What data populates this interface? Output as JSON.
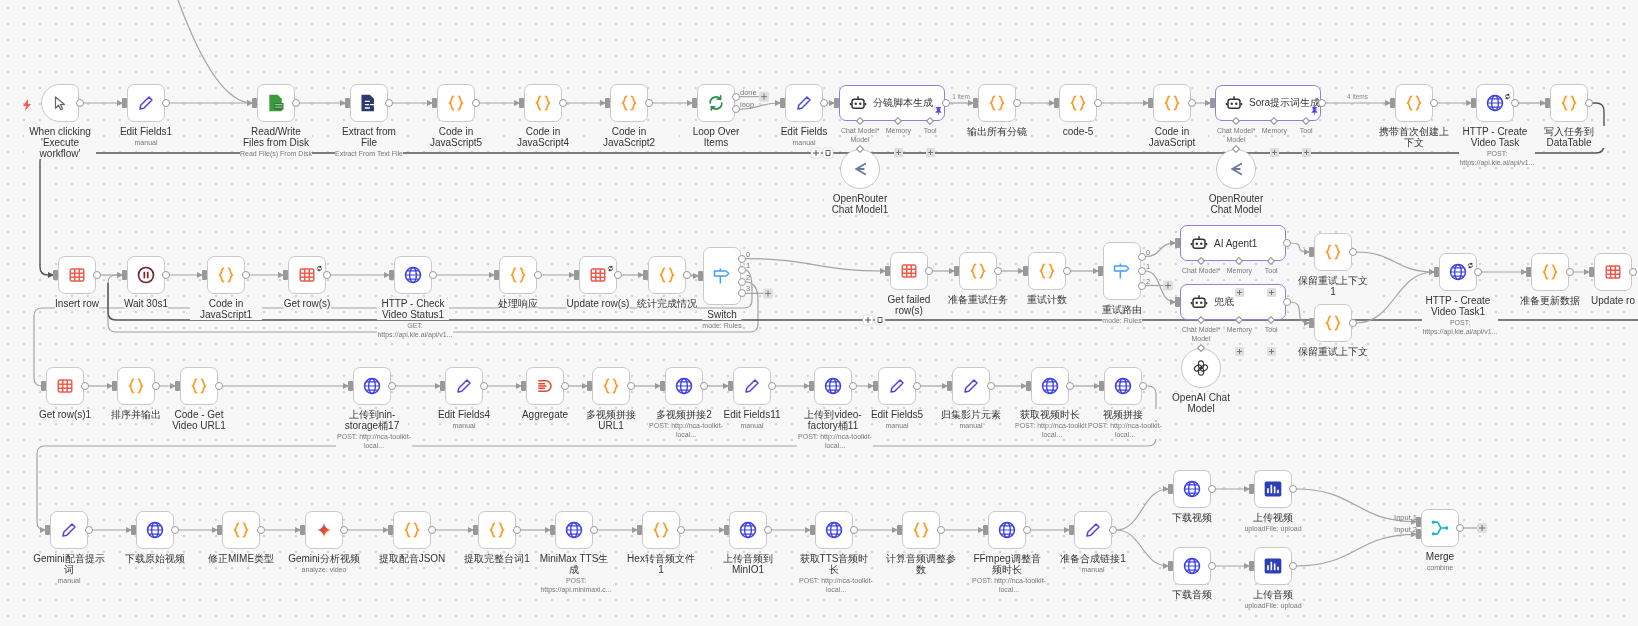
{
  "canvas": {
    "nodes": [
      {
        "kind": "trigger",
        "label": "When clicking 'Execute workflow'"
      },
      {
        "kind": "set",
        "label": "Edit Fields1",
        "subtitle": "manual"
      },
      {
        "kind": "file",
        "label": "Read/Write Files from Disk",
        "subtitle": "Read File(s) From Disk"
      },
      {
        "kind": "extract",
        "label": "Extract from File",
        "subtitle": "Extract From Text File"
      },
      {
        "kind": "code",
        "label": "Code in JavaScript5"
      },
      {
        "kind": "code",
        "label": "Code in JavaScript4"
      },
      {
        "kind": "code",
        "label": "Code in JavaScript2"
      },
      {
        "kind": "loop",
        "label": "Loop Over Items",
        "outputs": [
          "done",
          "loop"
        ]
      },
      {
        "kind": "set",
        "label": "Edit Fields",
        "subtitle": "manual"
      },
      {
        "kind": "agent",
        "label": "分镜脚本生成",
        "pinned": true,
        "ports": [
          "Chat Model*",
          "Memory",
          "Tool"
        ]
      },
      {
        "kind": "code",
        "label": "输出所有分镜"
      },
      {
        "kind": "code",
        "label": "code-5"
      },
      {
        "kind": "code",
        "label": "Code in JavaScript"
      },
      {
        "kind": "agent",
        "label": "Sora提示词生成",
        "pinned": true,
        "ports": [
          "Chat Model*",
          "Memory",
          "Tool"
        ]
      },
      {
        "kind": "code",
        "label": "携带首次创建上下文"
      },
      {
        "kind": "http",
        "label": "HTTP - Create Video Task",
        "subtitle": "POST: https://api.kie.ai/api/v1...",
        "badge": true
      },
      {
        "kind": "code",
        "label": "写入任务到DataTable"
      },
      {
        "kind": "model_router",
        "label": "OpenRouter Chat Model1",
        "port": "Model"
      },
      {
        "kind": "model_router",
        "label": "OpenRouter Chat Model",
        "port": "Model"
      },
      {
        "kind": "table",
        "label": "Insert row"
      },
      {
        "kind": "wait",
        "label": "Wait 30s1"
      },
      {
        "kind": "code",
        "label": "Code in JavaScript1"
      },
      {
        "kind": "table",
        "label": "Get row(s)",
        "badge": true
      },
      {
        "kind": "http",
        "label": "HTTP - Check Video Status1",
        "subtitle": "GET: https://api.kie.ai/api/v1..."
      },
      {
        "kind": "code",
        "label": "处理响应"
      },
      {
        "kind": "table",
        "label": "Update row(s)",
        "badge": true
      },
      {
        "kind": "code",
        "label": "统计完成情况"
      },
      {
        "kind": "switch",
        "label": "Switch",
        "subtitle": "mode: Rules",
        "outputs": [
          "0",
          "1",
          "2",
          "3"
        ]
      },
      {
        "kind": "table",
        "label": "Get failed row(s)"
      },
      {
        "kind": "code",
        "label": "准备重试任务"
      },
      {
        "kind": "code",
        "label": "重试计数"
      },
      {
        "kind": "switch",
        "label": "重试路由",
        "subtitle": "mode: Rules",
        "outputs": [
          "0",
          "1",
          "2"
        ]
      },
      {
        "kind": "agent",
        "label": "AI Agent1",
        "pinned": false,
        "ports": [
          "Chat Model*",
          "Memory",
          "Tool"
        ]
      },
      {
        "kind": "agent",
        "label": "兜底",
        "pinned": false,
        "ports": [
          "Chat Model*",
          "Memory",
          "Tool"
        ]
      },
      {
        "kind": "code",
        "label": "保留重试上下文1"
      },
      {
        "kind": "code",
        "label": "保留重试上下文"
      },
      {
        "kind": "http",
        "label": "HTTP - Create Video Task1",
        "subtitle": "POST: https://api.kie.ai/api/v1...",
        "badge": true
      },
      {
        "kind": "code",
        "label": "准备更新数据"
      },
      {
        "kind": "table",
        "label": "Update ro"
      },
      {
        "kind": "model_openai",
        "label": "OpenAI Chat Model",
        "port": "Model"
      },
      {
        "kind": "table",
        "label": "Get row(s)1"
      },
      {
        "kind": "code",
        "label": "排序并输出"
      },
      {
        "kind": "code",
        "label": "Code - Get Video URL1"
      },
      {
        "kind": "http",
        "label": "上传到nin-storage桶17",
        "subtitle": "POST: http://nca-toolkit-local..."
      },
      {
        "kind": "set",
        "label": "Edit Fields4",
        "subtitle": "manual"
      },
      {
        "kind": "aggregate",
        "label": "Aggregate"
      },
      {
        "kind": "code",
        "label": "多视频拼接URL1"
      },
      {
        "kind": "http",
        "label": "多视频拼接2",
        "subtitle": "POST: http://nca-toolkit-local..."
      },
      {
        "kind": "set",
        "label": "Edit Fields11",
        "subtitle": "manual"
      },
      {
        "kind": "http",
        "label": "上传到video-factory桶11",
        "subtitle": "POST: http://nca-toolkit-local..."
      },
      {
        "kind": "set",
        "label": "Edit Fields5",
        "subtitle": "manual"
      },
      {
        "kind": "set",
        "label": "归集影片元素",
        "subtitle": "manual"
      },
      {
        "kind": "http",
        "label": "获取视频时长",
        "subtitle": "POST: http://nca-toolkit-local..."
      },
      {
        "kind": "http",
        "label": "视频拼接",
        "subtitle": "POST: http://nca-toolkit-local..."
      },
      {
        "kind": "set",
        "label": "Gemini配音提示词",
        "subtitle": "manual"
      },
      {
        "kind": "http",
        "label": "下载原始视频"
      },
      {
        "kind": "code",
        "label": "修正MIME类型"
      },
      {
        "kind": "gemini",
        "label": "Gemini分析视频",
        "subtitle": "analyze: video"
      },
      {
        "kind": "code",
        "label": "提取配音JSON"
      },
      {
        "kind": "code",
        "label": "提取完整台词1"
      },
      {
        "kind": "http",
        "label": "MiniMax TTS生成",
        "subtitle": "POST: https://api.minimaxi.c..."
      },
      {
        "kind": "code",
        "label": "Hex转音频文件1"
      },
      {
        "kind": "http",
        "label": "上传音频到MinIO1"
      },
      {
        "kind": "http",
        "label": "获取TTS音频时长",
        "subtitle": "POST: http://nca-toolkit-local..."
      },
      {
        "kind": "code",
        "label": "计算音频调整参数"
      },
      {
        "kind": "http",
        "label": "FFmpeg调整音频时长",
        "subtitle": "POST: http://nca-toolkit-local..."
      },
      {
        "kind": "set",
        "label": "准备合成链接1",
        "subtitle": "manual"
      },
      {
        "kind": "http",
        "label": "下载视频"
      },
      {
        "kind": "storage",
        "label": "上传视频",
        "subtitle": "uploadFile: upload"
      },
      {
        "kind": "http",
        "label": "下载音频"
      },
      {
        "kind": "storage",
        "label": "上传音频",
        "subtitle": "uploadFile: upload"
      },
      {
        "kind": "merge",
        "label": "Merge",
        "subtitle": "combine",
        "inputs": [
          "Input 1",
          "Input 2"
        ]
      }
    ],
    "edge_labels": [
      "1 item",
      "4 items"
    ]
  }
}
